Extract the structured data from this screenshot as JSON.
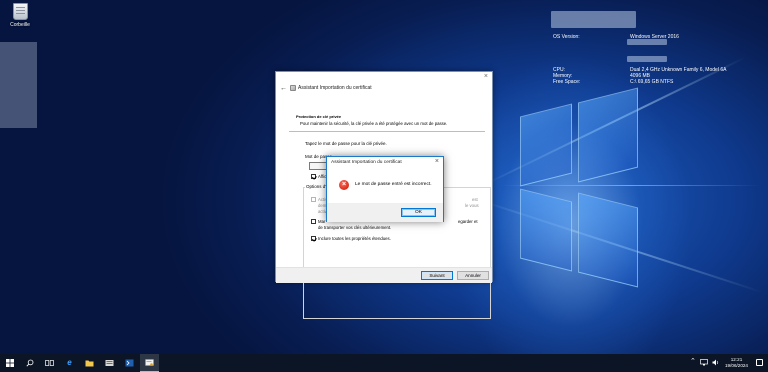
{
  "desktop": {
    "recycle_bin_label": "Corbeille"
  },
  "bginfo": {
    "os_label": "OS Version:",
    "os_value": "Windows Server 2016",
    "cpu_label": "CPU:",
    "cpu_value": "Dual 2,4 GHz Unknown Family 6, Model 6A",
    "memory_label": "Memory:",
    "memory_value": "4096 MB",
    "free_space_label": "Free Space:",
    "free_space_value": "C:\\ 69,65 GB NTFS"
  },
  "wizard": {
    "title": "Assistant Importation du certificat",
    "section_title": "Protection de clé privée",
    "section_desc": "Pour maintenir la sécurité, la clé privée a été protégée avec un mot de passe.",
    "prompt": "Tapez le mot de passe pour la clé privée.",
    "password_label": "Mot de passe",
    "show_password_label": "Afficher",
    "options_label": "Options d'i",
    "option_strong_protection_line1": "Activ",
    "option_strong_protection_line1_tail": "est",
    "option_strong_protection_line2": "dema",
    "option_strong_protection_line2_tail": "le vous",
    "option_strong_protection_line3": "active",
    "option_exportable_line1": "Mar",
    "option_exportable_line1_tail": "egarder et",
    "option_exportable_line2": "de transporter vos clés ultérieurement.",
    "option_include_props": "Inclure toutes les propriétés étendues.",
    "next_button": "Suivant",
    "cancel_button": "Annuler"
  },
  "error_dialog": {
    "title": "Assistant Importation du certificat",
    "message": "Le mot de passe entré est incorrect.",
    "ok_button": "OK"
  },
  "taskbar": {
    "time": "12:21",
    "date": "19/06/2024"
  },
  "colors": {
    "accent": "#0078d7",
    "error_red": "#d92b1b",
    "taskbar": "#0b1526"
  }
}
